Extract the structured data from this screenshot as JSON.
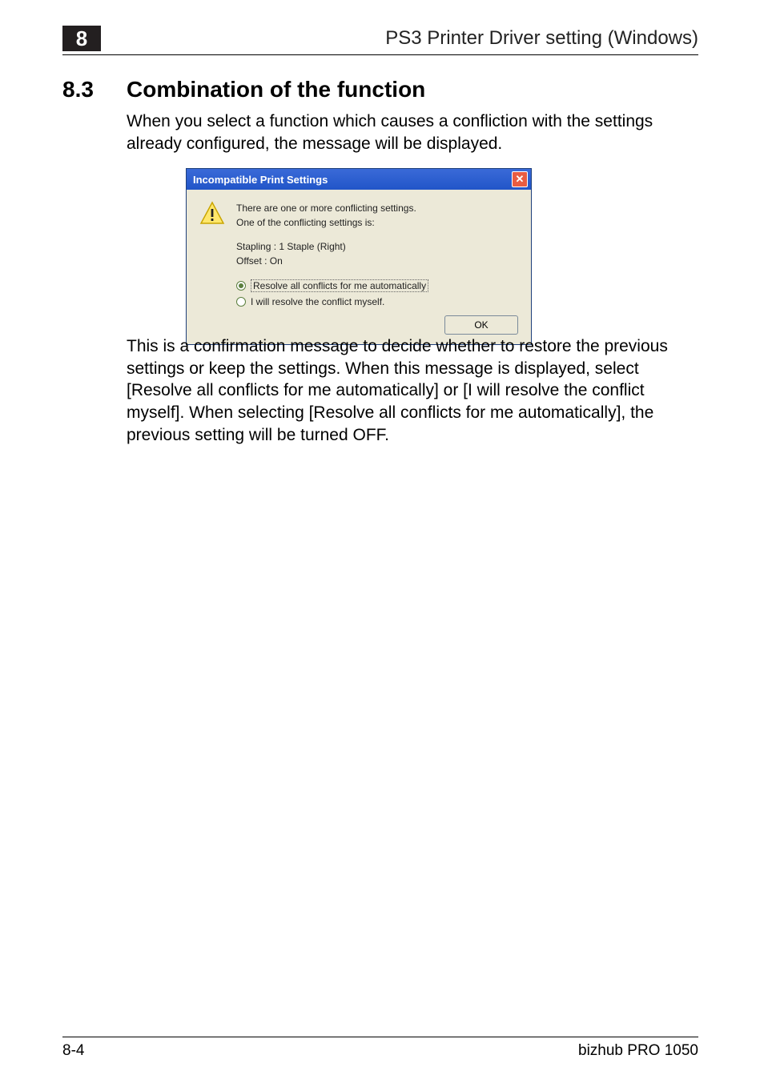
{
  "header": {
    "chapter_number": "8",
    "running_title": "PS3 Printer Driver setting (Windows)"
  },
  "section": {
    "number": "8.3",
    "title": "Combination of the function"
  },
  "paragraphs": {
    "intro": "When you select a function which causes a confliction with the settings already configured, the message will be displayed.",
    "followup": "This is a confirmation message to decide whether to restore the previous settings or keep the settings. When this message is displayed, select [Resolve all conflicts for me automatically] or [I will resolve the conflict myself]. When selecting [Resolve all conflicts for me automatically], the previous setting will be turned OFF."
  },
  "dialog": {
    "title": "Incompatible Print Settings",
    "close_glyph": "✕",
    "message_line1": "There are one or more conflicting settings.",
    "message_line2": "One of the conflicting settings is:",
    "conflict_line1": "Stapling : 1 Staple (Right)",
    "conflict_line2": "Offset : On",
    "radios": {
      "option1": "Resolve all conflicts for me automatically",
      "option2": "I will resolve the conflict myself.",
      "selected_index": 0
    },
    "ok_label": "OK"
  },
  "footer": {
    "page_number": "8-4",
    "product": "bizhub PRO 1050"
  }
}
